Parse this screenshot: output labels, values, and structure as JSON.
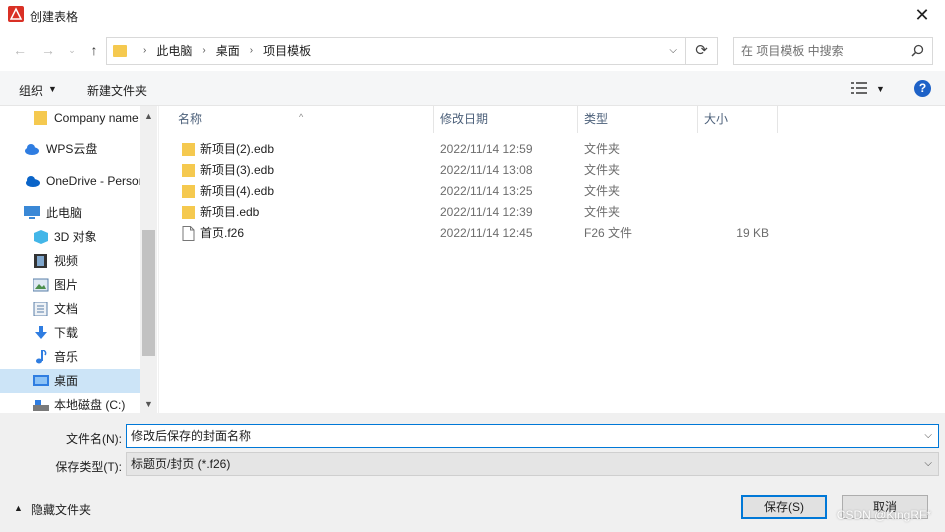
{
  "window": {
    "title": "创建表格",
    "close_label": "✕"
  },
  "nav": {
    "crumbs": [
      "此电脑",
      "桌面",
      "项目模板"
    ],
    "search_placeholder": "在 项目模板 中搜索"
  },
  "toolbar": {
    "organize": "组织",
    "new_folder": "新建文件夹",
    "help": "?"
  },
  "sidebar": {
    "items": [
      {
        "label": "Company name",
        "icon": "folder-icon"
      },
      {
        "label": "WPS云盘",
        "icon": "cloud-icon"
      },
      {
        "label": "OneDrive - Personal",
        "icon": "onedrive-icon"
      },
      {
        "label": "此电脑",
        "icon": "computer-icon"
      },
      {
        "label": "3D 对象",
        "icon": "cube-icon"
      },
      {
        "label": "视频",
        "icon": "video-icon"
      },
      {
        "label": "图片",
        "icon": "picture-icon"
      },
      {
        "label": "文档",
        "icon": "document-icon"
      },
      {
        "label": "下载",
        "icon": "download-icon"
      },
      {
        "label": "音乐",
        "icon": "music-icon"
      },
      {
        "label": "桌面",
        "icon": "desktop-icon"
      },
      {
        "label": "本地磁盘 (C:)",
        "icon": "drive-icon"
      }
    ]
  },
  "columns": {
    "name": "名称",
    "date": "修改日期",
    "type": "类型",
    "size": "大小"
  },
  "files": [
    {
      "name": "新项目(2).edb",
      "date": "2022/11/14 12:59",
      "type": "文件夹",
      "size": "",
      "icon": "folder-icon"
    },
    {
      "name": "新项目(3).edb",
      "date": "2022/11/14 13:08",
      "type": "文件夹",
      "size": "",
      "icon": "folder-icon"
    },
    {
      "name": "新项目(4).edb",
      "date": "2022/11/14 13:25",
      "type": "文件夹",
      "size": "",
      "icon": "folder-icon"
    },
    {
      "name": "新项目.edb",
      "date": "2022/11/14 12:39",
      "type": "文件夹",
      "size": "",
      "icon": "folder-icon"
    },
    {
      "name": "首页.f26",
      "date": "2022/11/14 12:45",
      "type": "F26 文件",
      "size": "19 KB",
      "icon": "file-icon"
    }
  ],
  "form": {
    "filename_label": "文件名(N):",
    "filename_value": "修改后保存的封面名称",
    "filetype_label": "保存类型(T):",
    "filetype_value": "标题页/封页 (*.f26)",
    "hide_folders": "隐藏文件夹",
    "save": "保存(S)",
    "cancel": "取消"
  },
  "watermark": "CSDN @KingRF*",
  "colors": {
    "accent": "#0078d7",
    "folder": "#f5c94f",
    "selected": "#cce4f7"
  }
}
